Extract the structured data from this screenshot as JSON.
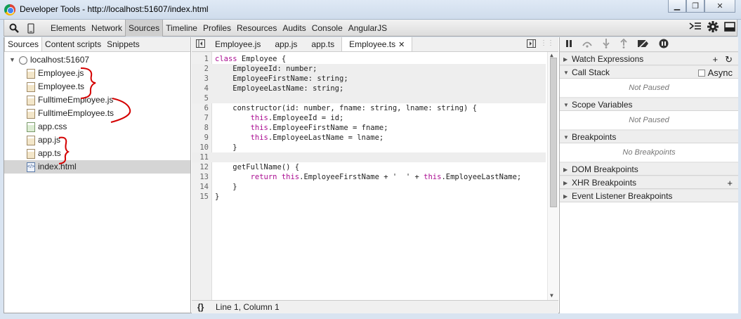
{
  "window": {
    "title": "Developer Tools - http://localhost:51607/index.html"
  },
  "toolbar": {
    "tabs": [
      "Elements",
      "Network",
      "Sources",
      "Timeline",
      "Profiles",
      "Resources",
      "Audits",
      "Console",
      "AngularJS"
    ],
    "selected_tab": "Sources"
  },
  "navigator": {
    "tabs": [
      "Sources",
      "Content scripts",
      "Snippets"
    ],
    "root": "localhost:51607",
    "files": [
      "Employee.js",
      "Employee.ts",
      "FulltimeEmployee.js",
      "FulltimeEmployee.ts",
      "app.css",
      "app.js",
      "app.ts",
      "index.html"
    ],
    "selected_file": "index.html"
  },
  "editor": {
    "tabs": [
      "Employee.js",
      "app.js",
      "app.ts",
      "Employee.ts"
    ],
    "active_tab": "Employee.ts",
    "line_numbers": [
      "1",
      "2",
      "3",
      "4",
      "5",
      "6",
      "7",
      "8",
      "9",
      "10",
      "11",
      "12",
      "13",
      "14",
      "15"
    ],
    "status": "Line 1, Column 1",
    "format_label": "{}"
  },
  "debugger": {
    "watch_expressions": "Watch Expressions",
    "call_stack": "Call Stack",
    "async_label": "Async",
    "not_paused_1": "Not Paused",
    "scope_variables": "Scope Variables",
    "not_paused_2": "Not Paused",
    "breakpoints": "Breakpoints",
    "no_breakpoints": "No Breakpoints",
    "dom_breakpoints": "DOM Breakpoints",
    "xhr_breakpoints": "XHR Breakpoints",
    "event_listener_breakpoints": "Event Listener Breakpoints"
  },
  "colors": {
    "keyword": "#aa0d91",
    "annotation": "#d40000"
  }
}
